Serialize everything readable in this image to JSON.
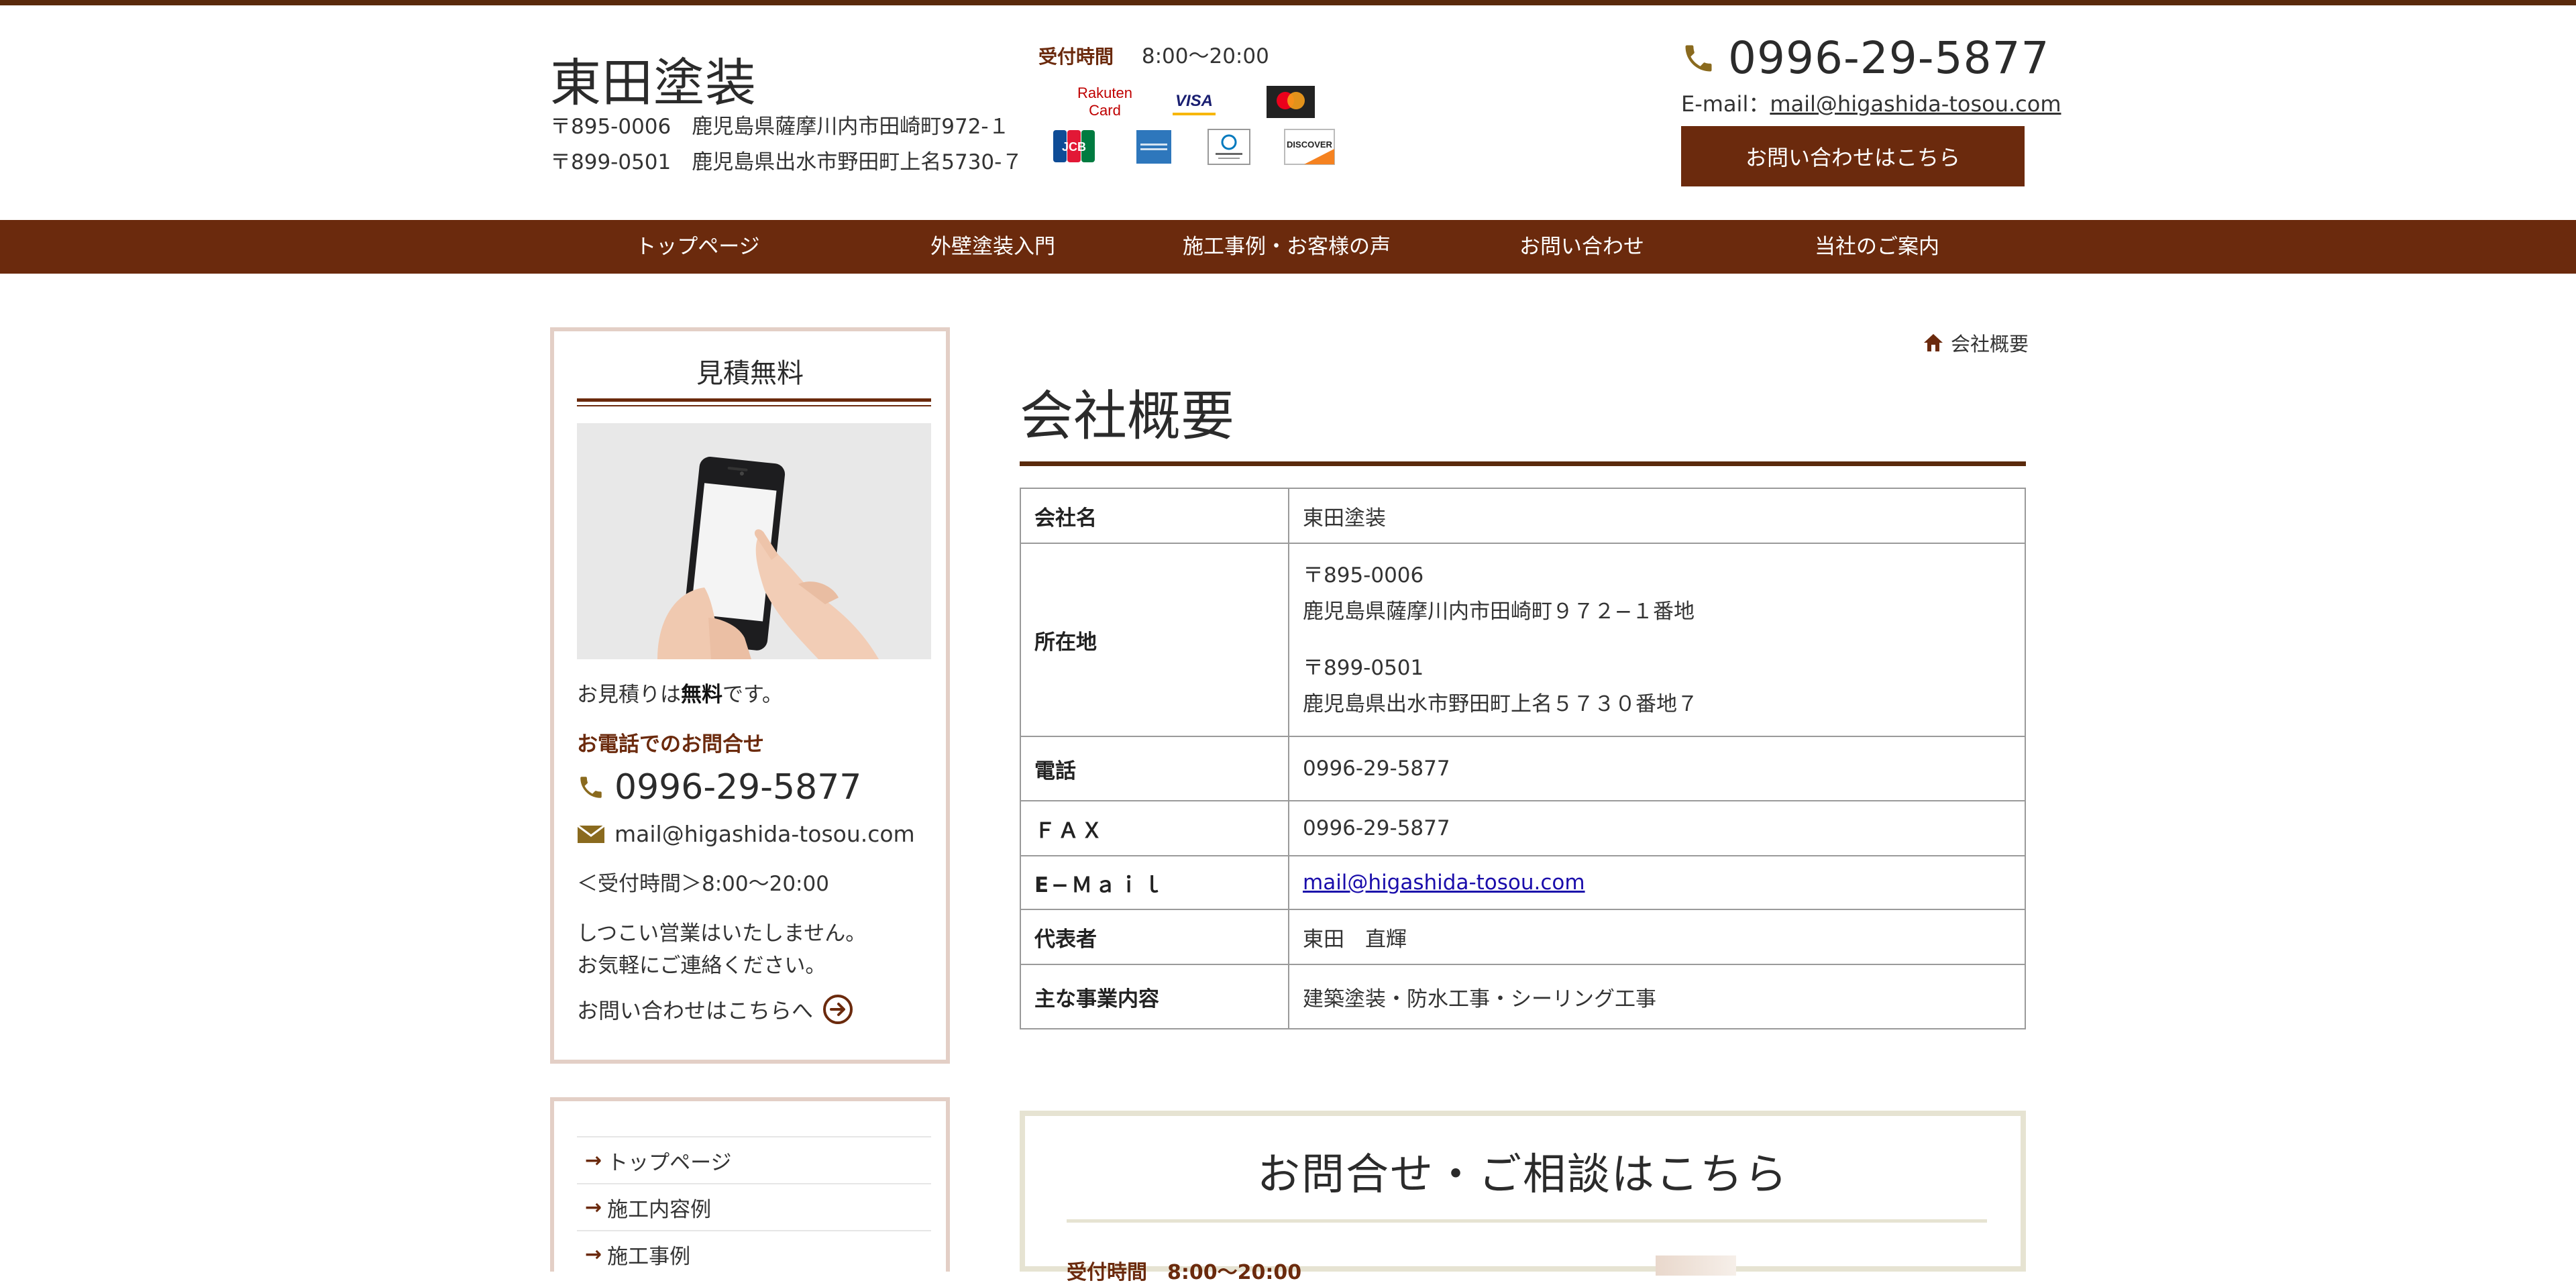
{
  "header": {
    "company_name": "東田塗装",
    "address_line1": "〒895-0006　鹿児島県薩摩川内市田崎町972-１",
    "address_line2": "〒899-0501　鹿児島県出水市野田町上名5730-７",
    "hours_label": "受付時間",
    "hours_value": "8:00〜20:00",
    "phone": "0996-29-5877",
    "email_label": "E-mail：",
    "email": "mail@higashida-tosou.com",
    "contact_button": "お問い合わせはこちら",
    "payment_cards": {
      "rakuten_line1": "Rakuten",
      "rakuten_line2": "Card",
      "visa": "VISA",
      "jcb": "JCB",
      "discover": "DISCOVER"
    }
  },
  "nav": {
    "items": [
      {
        "label": "トップページ"
      },
      {
        "label": "外壁塗装入門"
      },
      {
        "label": "施工事例・お客様の声"
      },
      {
        "label": "お問い合わせ"
      },
      {
        "label": "当社のご案内"
      }
    ]
  },
  "sidebar": {
    "title": "見積無料",
    "free_text_prefix": "お見積りは",
    "free_text_bold": "無料",
    "free_text_suffix": "です。",
    "phone_label": "お電話でのお問合せ",
    "phone": "0996-29-5877",
    "email": "mail@higashida-tosou.com",
    "hours": "＜受付時間＞8:00〜20:00",
    "note_line1": "しつこい営業はいたしません。",
    "note_line2": "お気軽にご連絡ください。",
    "contact_link": "お問い合わせはこちらへ",
    "menu": [
      {
        "label": "トップページ"
      },
      {
        "label": "施工内容例"
      },
      {
        "label": "施工事例"
      }
    ]
  },
  "breadcrumb": {
    "current": "会社概要"
  },
  "main": {
    "title": "会社概要",
    "table": {
      "rows": [
        {
          "key": "会社名",
          "value": "東田塗装"
        },
        {
          "key": "所在地",
          "zip1": "〒895-0006",
          "addr1": "鹿児島県薩摩川内市田崎町９７２−１番地",
          "zip2": "〒899-0501",
          "addr2": "鹿児島県出水市野田町上名５７３０番地７"
        },
        {
          "key": "電話",
          "value": "0996-29-5877"
        },
        {
          "key": "ＦＡＸ",
          "value": "0996-29-5877"
        },
        {
          "key": "E−Ｍａｉｌ",
          "value": "mail@higashida-tosou.com"
        },
        {
          "key": "代表者",
          "value": "東田　直輝"
        },
        {
          "key": "主な事業内容",
          "value": "建築塗装・防水工事・シーリング工事"
        }
      ]
    },
    "contact_box": {
      "title": "お問合せ・ご相談はこちら",
      "hours_label": "受付時間　8:00〜20:00"
    }
  },
  "colors": {
    "brand_brown": "#6b2a0d",
    "dark_line": "#5a2a0c",
    "sidebar_border": "#e3cfc6",
    "phone_icon": "#8a6a1e"
  }
}
